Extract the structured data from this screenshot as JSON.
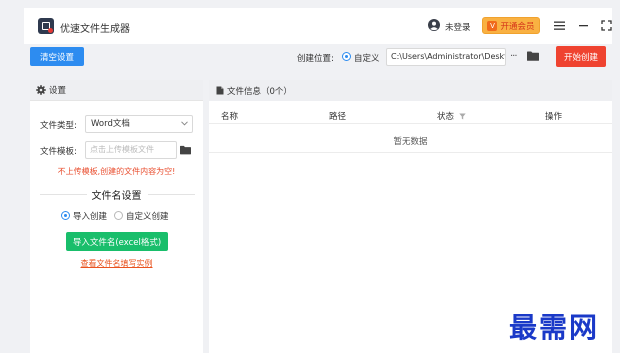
{
  "app": {
    "title": "优速文件生成器"
  },
  "header": {
    "login_label": "未登录",
    "vip_label": "开通会员",
    "vip_badge": "V"
  },
  "toolbar": {
    "clear_label": "清空设置",
    "location_label": "创建位置:",
    "custom_label": "自定义",
    "path_value": "C:\\Users\\Administrator\\Deskto",
    "more_label": "···",
    "start_label": "开始创建"
  },
  "settings": {
    "title": "设置",
    "type_label": "文件类型:",
    "type_value": "Word文档",
    "template_label": "文件模板:",
    "template_placeholder": "点击上传模板文件",
    "warning": "不上传模板,创建的文件内容为空!",
    "filename_section": "文件名设置",
    "import_option": "导入创建",
    "custom_option": "自定义创建",
    "import_button": "导入文件名(excel格式)",
    "example_link": "查看文件名填写实例"
  },
  "fileinfo": {
    "title": "文件信息（0个）",
    "columns": [
      "名称",
      "路径",
      "状态",
      "操作"
    ],
    "empty": "暂无数据"
  },
  "watermark": "最需网",
  "colors": {
    "primary": "#2d8cf0",
    "danger": "#ef4330",
    "success": "#19be6b",
    "vip": "#f9b142"
  }
}
